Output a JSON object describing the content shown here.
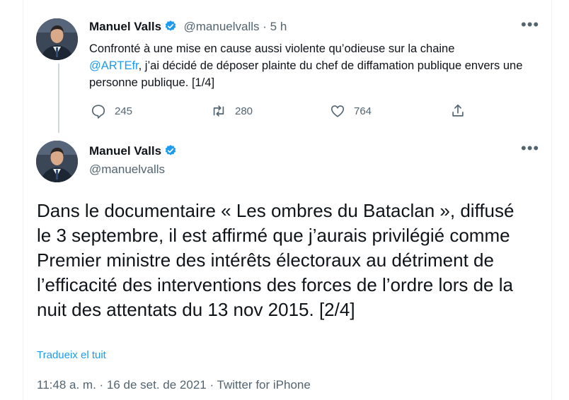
{
  "tweet1": {
    "name": "Manuel Valls",
    "handle": "@manuelvalls",
    "sep": " · ",
    "time": "5 h",
    "text_a": "Confronté à une mise en cause aussi violente qu’odieuse sur la chaine",
    "mention": "@ARTEfr",
    "text_b": ", j’ai décidé de déposer plainte du chef de diffamation publique envers une personne publique. [1/4]",
    "replies": "245",
    "retweets": "280",
    "likes": "764",
    "more_label": "•••"
  },
  "tweet2": {
    "name": "Manuel Valls",
    "handle": "@manuelvalls",
    "more_label": "•••",
    "text": "Dans le documentaire « Les ombres du Bataclan », diffusé le 3 septembre, il est affirmé que j’aurais privilégié comme Premier ministre des intérêts électoraux au détriment de l’efficacité des interventions des forces de l’ordre lors de la nuit des attentats du 13 nov 2015. [2/4]",
    "translate": "Tradueix el tuit",
    "meta": "11:48 a. m. · 16 de set. de 2021 · Twitter for iPhone"
  },
  "colors": {
    "accent": "#1d9bf0",
    "secondary_text": "#536471",
    "primary_text": "#0f1419"
  },
  "icons": [
    "verified-badge-icon",
    "reply-icon",
    "retweet-icon",
    "like-icon",
    "share-icon",
    "more-icon"
  ]
}
